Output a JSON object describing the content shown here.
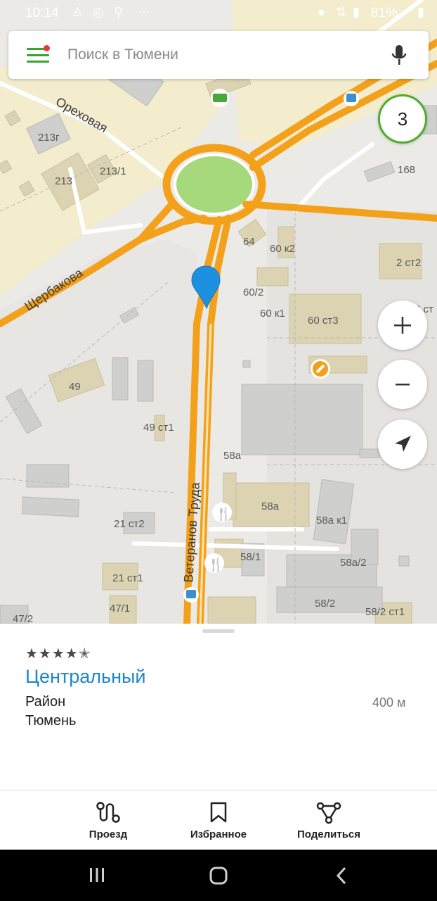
{
  "status_bar": {
    "time": "10:14",
    "battery": "81%"
  },
  "search": {
    "placeholder": "Поиск в Тюмени"
  },
  "traffic_level": "3",
  "map": {
    "streets": [
      "Ореховая",
      "Щербакова",
      "Ветеранов Труда"
    ],
    "building_labels": [
      "213г",
      "213",
      "213/1",
      "168",
      "64",
      "60 к2",
      "60/2",
      "60 к1",
      "60 ст3",
      "2 ст2",
      "2 ст",
      "49",
      "49 ст1",
      "58а",
      "58а",
      "58а к1",
      "21 ст2",
      "21 ст1",
      "47/1",
      "47/2",
      "58/1",
      "58а/2",
      "58/2",
      "58/2 ст1"
    ]
  },
  "place": {
    "rating": "★★★★✭",
    "name": "Центральный",
    "type": "Район",
    "city": "Тюмень",
    "distance": "400 м"
  },
  "actions": {
    "route": "Проезд",
    "favorite": "Избранное",
    "share": "Поделиться"
  },
  "colors": {
    "accent_green": "#3aa332",
    "link_blue": "#1f86c8",
    "pin_blue": "#1e90e0",
    "road_orange": "#f3a11b"
  }
}
